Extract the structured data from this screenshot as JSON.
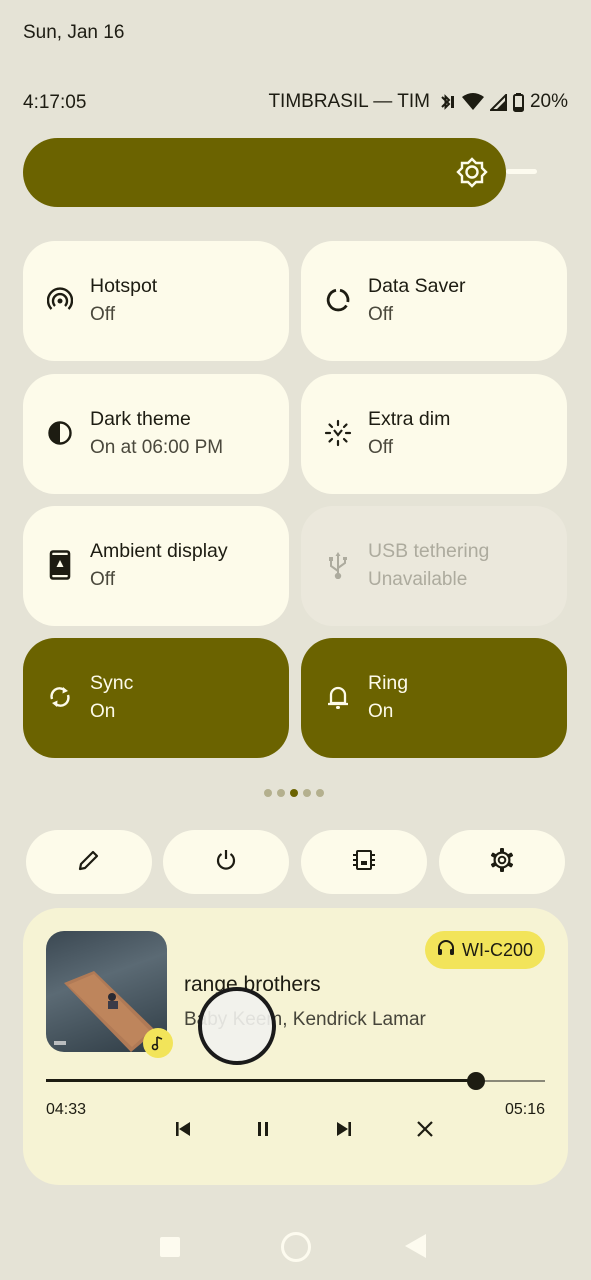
{
  "header": {
    "date": "Sun, Jan 16",
    "time": "4:17:05",
    "carrier": "TIMBRASIL — TIM",
    "battery": "20%"
  },
  "brightness": {
    "level": 0.86,
    "icon": "brightness-icon"
  },
  "tiles": [
    {
      "label": "Hotspot",
      "status": "Off",
      "icon": "hotspot-icon",
      "state": "off"
    },
    {
      "label": "Data Saver",
      "status": "Off",
      "icon": "data-saver-icon",
      "state": "off"
    },
    {
      "label": "Dark theme",
      "status": "On at 06:00 PM",
      "icon": "dark-theme-icon",
      "state": "off"
    },
    {
      "label": "Extra dim",
      "status": "Off",
      "icon": "extra-dim-icon",
      "state": "off"
    },
    {
      "label": "Ambient display",
      "status": "Off",
      "icon": "ambient-display-icon",
      "state": "off"
    },
    {
      "label": "USB tethering",
      "status": "Unavailable",
      "icon": "usb-icon",
      "state": "disabled"
    },
    {
      "label": "Sync",
      "status": "On",
      "icon": "sync-icon",
      "state": "on"
    },
    {
      "label": "Ring",
      "status": "On",
      "icon": "bell-icon",
      "state": "on"
    }
  ],
  "pager": {
    "pages": 5,
    "current": 3
  },
  "quick_buttons": [
    "edit-icon",
    "power-icon",
    "device-controls-icon",
    "settings-icon"
  ],
  "media": {
    "device": "WI-C200",
    "title": "range brothers",
    "artist": "Baby Keem, Kendrick Lamar",
    "elapsed": "04:33",
    "duration": "05:16",
    "progress": 0.864,
    "controls": [
      "previous-icon",
      "pause-icon",
      "next-icon",
      "close-icon"
    ]
  },
  "colors": {
    "background": "#e5e3d6",
    "accent": "#6b6300",
    "tile": "#fdfbea",
    "media": "#f6f3d4",
    "chip": "#f2e45a"
  }
}
